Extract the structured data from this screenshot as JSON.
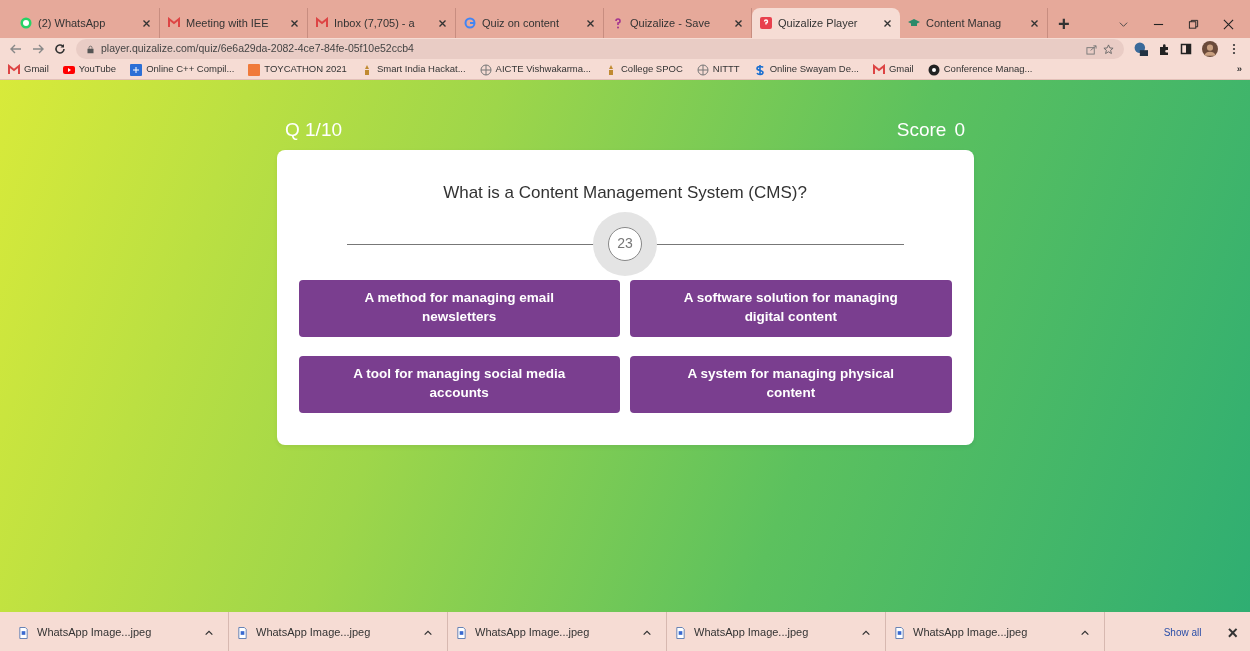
{
  "browser": {
    "tabs": [
      {
        "title": "(2) WhatsApp",
        "selected": false
      },
      {
        "title": "Meeting with IEE",
        "selected": false
      },
      {
        "title": "Inbox (7,705) - a",
        "selected": false
      },
      {
        "title": "Quiz on content",
        "selected": false
      },
      {
        "title": "Quizalize - Save",
        "selected": false
      },
      {
        "title": "Quizalize Player",
        "selected": true
      },
      {
        "title": "Content Manag",
        "selected": false
      }
    ],
    "new_tab": "+",
    "address": "player.quizalize.com/quiz/6e6a29da-2082-4ce7-84fe-05f10e52ccb4",
    "bookmarks": [
      {
        "label": "Gmail"
      },
      {
        "label": "YouTube"
      },
      {
        "label": "Online C++ Compil..."
      },
      {
        "label": "TOYCATHON 2021"
      },
      {
        "label": "Smart India Hackat..."
      },
      {
        "label": "AICTE Vishwakarma..."
      },
      {
        "label": "College SPOC"
      },
      {
        "label": "NITTT"
      },
      {
        "label": "Online Swayam De..."
      },
      {
        "label": "Gmail"
      },
      {
        "label": "Conference Manag..."
      }
    ],
    "more_bookmarks": "»"
  },
  "quiz": {
    "progress": "Q 1/10",
    "score_label": "Score",
    "score": "0",
    "question": "What is a Content Management System (CMS)?",
    "timer": "23",
    "answers": [
      {
        "text": "A method for managing email newsletters"
      },
      {
        "text": "A software solution for managing digital content"
      },
      {
        "text": "A tool for managing social media accounts"
      },
      {
        "text": "A system for managing physical content"
      }
    ]
  },
  "downloads": {
    "items": [
      {
        "name": "WhatsApp Image...jpeg"
      },
      {
        "name": "WhatsApp Image...jpeg"
      },
      {
        "name": "WhatsApp Image...jpeg"
      },
      {
        "name": "WhatsApp Image...jpeg"
      },
      {
        "name": "WhatsApp Image...jpeg"
      }
    ],
    "show_all": "Show all",
    "close": "×"
  }
}
